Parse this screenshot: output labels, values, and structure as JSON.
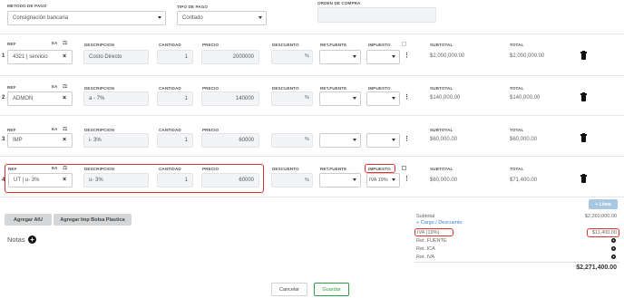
{
  "top": {
    "metodo_pago_label": "METODO DE PAGO",
    "metodo_pago_value": "Consignación bancaria",
    "tipo_pago_label": "TIPO DE PAGO",
    "tipo_pago_value": "Contado",
    "orden_compra_label": "ORDEN DE COMPRA"
  },
  "headers": {
    "ref": "REF",
    "ea": "EA",
    "descripcion": "DESCRIPCION",
    "cantidad": "CANTIDAD",
    "precio": "PRECIO",
    "descuento": "DESCUENTO",
    "ret_fuente": "RET.FUENTE",
    "impuesto": "IMPUESTO",
    "subtotal": "SUBTOTAL",
    "total": "TOTAL"
  },
  "rows": [
    {
      "num": "1",
      "ref": "4321 | servicio",
      "descripcion": "Costo Directo",
      "cantidad": "1",
      "precio": "2000000",
      "pct": "%",
      "impuesto": "",
      "subtotal": "$2,000,000.00",
      "total": "$2,000,000.00"
    },
    {
      "num": "2",
      "ref": "ADMON",
      "descripcion": "a - 7%",
      "cantidad": "1",
      "precio": "140000",
      "pct": "%",
      "impuesto": "",
      "subtotal": "$140,000.00",
      "total": "$140,000.00"
    },
    {
      "num": "3",
      "ref": "IMP",
      "descripcion": "i- 3%",
      "cantidad": "1",
      "precio": "60000",
      "pct": "%",
      "impuesto": "",
      "subtotal": "$60,000.00",
      "total": "$60,000.00"
    },
    {
      "num": "4",
      "ref": "UT | u- 3%",
      "descripcion": "u- 3%",
      "cantidad": "1",
      "precio": "60000",
      "pct": "%",
      "impuesto": "IVA 19%",
      "subtotal": "$60,000.00",
      "total": "$71,400.00"
    }
  ],
  "icons": {
    "remove": "×",
    "kebab": "⋮",
    "plus": "+"
  },
  "buttons": {
    "linea": "+ Línea",
    "agregar_aiu": "Agregar AIU",
    "agregar_bolsa": "Agregar Imp Bolsa Plastica",
    "cancelar": "Cancelar",
    "guardar": "Guardar"
  },
  "notas_label": "Notas",
  "summary": {
    "subtotal_label": "Subtotal",
    "subtotal_value": "$2,260,000.00",
    "cargo_descuento": "+ Cargo / Descuento",
    "iva_label": "IVA (19%)",
    "iva_value": "$11,400.00",
    "ret_fuente": "Ret. FUENTE",
    "ret_ica": "Ret. ICA",
    "ret_iva": "Ret. IVA",
    "total_value": "$2,271,400.00"
  },
  "colors": {
    "highlight": "#e03131",
    "guardar_text": "#2f9e44",
    "link": "#3b7dd8"
  }
}
